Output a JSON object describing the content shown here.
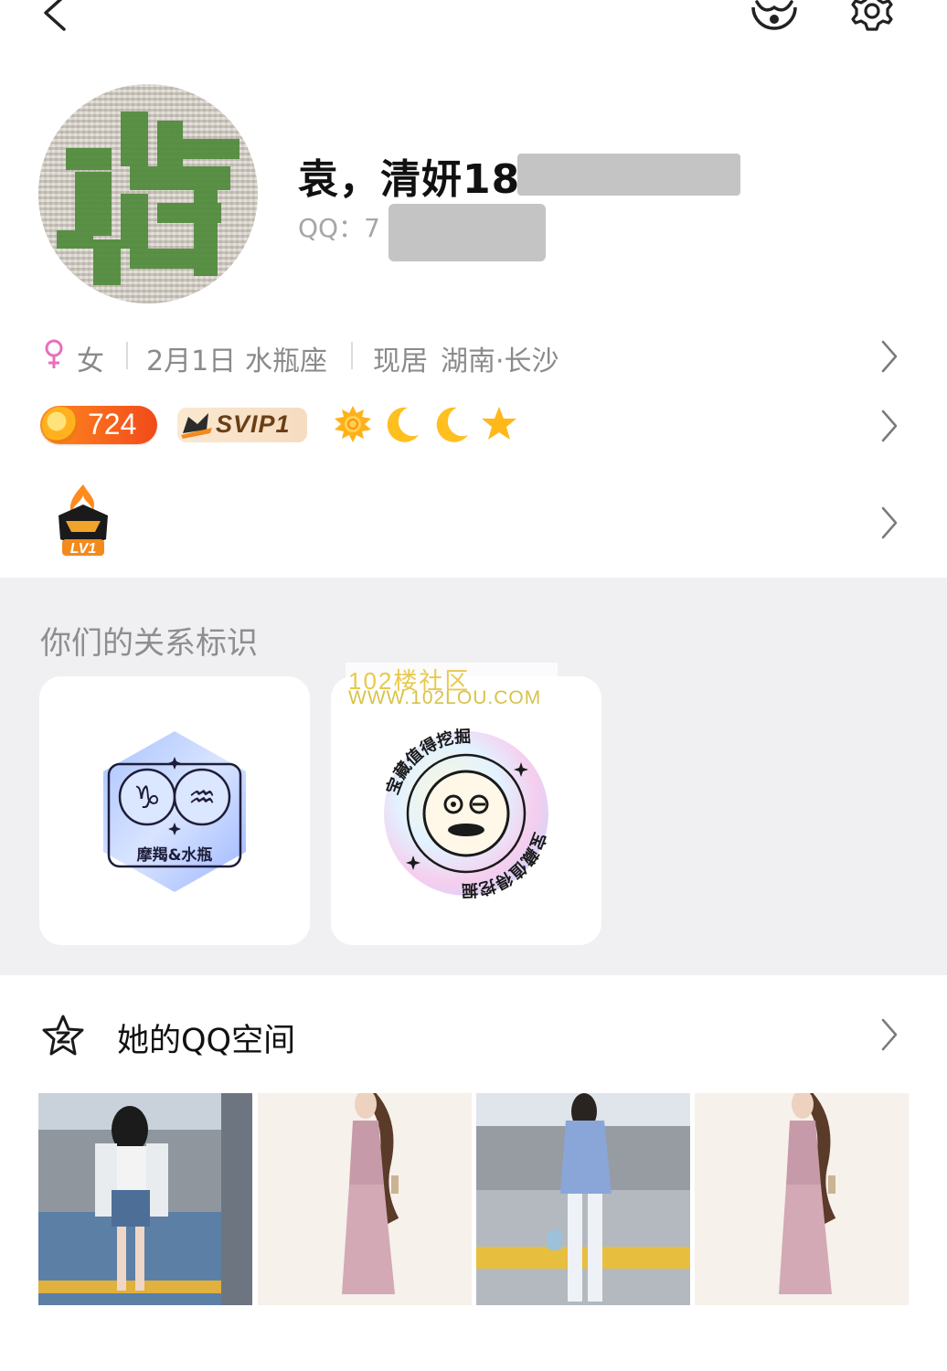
{
  "topbar": {
    "back_icon": "chevron-left-icon",
    "face_icon": "face-icon",
    "settings_icon": "gear-icon"
  },
  "profile": {
    "nickname": "袁，清妍188",
    "qq_label": "QQ：",
    "qq_value_visible": "7",
    "avatar_char": "藏"
  },
  "basic_info": {
    "gender": "女",
    "birthday": "2月1日",
    "zodiac": "水瓶座",
    "residence_label": "现居",
    "residence": "湖南·长沙"
  },
  "badges": {
    "level": "724",
    "svip": "SVIP1",
    "grade_icons": [
      "sun-icon",
      "moon-icon",
      "moon-icon",
      "star-icon"
    ]
  },
  "fire_badge": {
    "label": "LV1"
  },
  "relation": {
    "title": "你们的关系标识",
    "cards": [
      {
        "label": "摩羯&水瓶",
        "icon": "zodiac-badge-icon"
      },
      {
        "label": "宝藏值得挖掘",
        "icon": "treasure-badge-icon"
      }
    ],
    "watermark_line1": "102楼社区",
    "watermark_line2": "WWW.102LOU.COM"
  },
  "qzone": {
    "title": "她的QQ空间",
    "photo_count": 4
  },
  "colors": {
    "accent_orange": "#f14a1a",
    "svip_brown": "#6a3f16",
    "gender_pink": "#e86fbf",
    "section_gray": "#f0f0f3"
  }
}
